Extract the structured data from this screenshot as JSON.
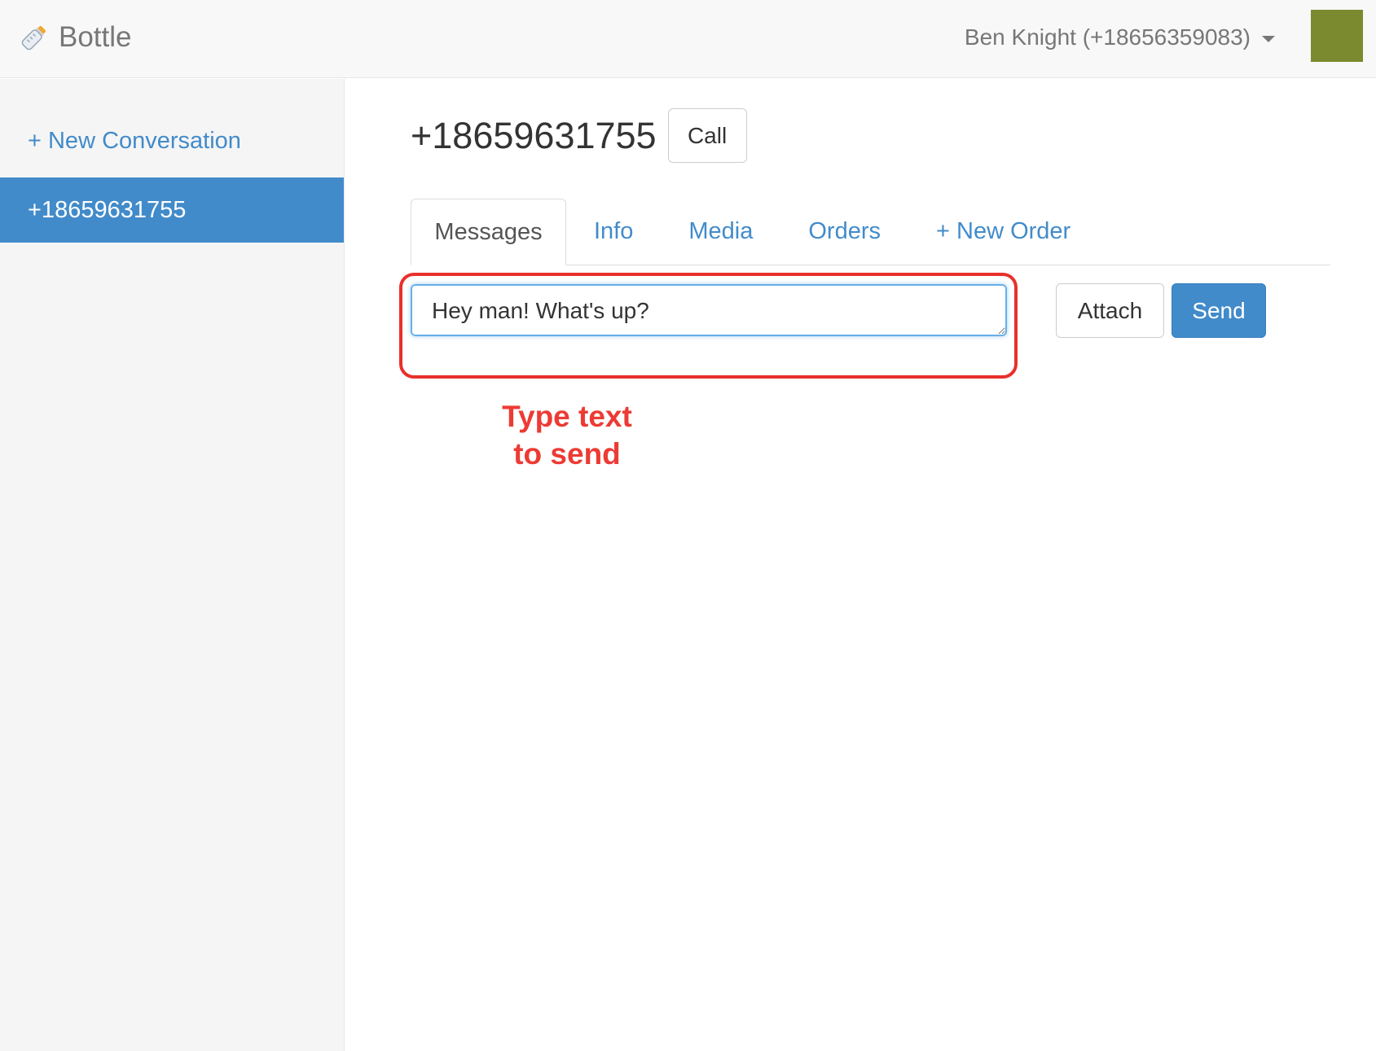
{
  "navbar": {
    "brand": "Bottle",
    "user": "Ben Knight (+18656359083)",
    "avatar_color": "#7b8a2e"
  },
  "sidebar": {
    "new_conversation": "+ New Conversation",
    "conversations": [
      {
        "label": "+18659631755",
        "selected": true
      }
    ]
  },
  "main": {
    "contact_number": "+18659631755",
    "call_label": "Call",
    "tabs": [
      {
        "label": "Messages",
        "active": true
      },
      {
        "label": "Info",
        "active": false
      },
      {
        "label": "Media",
        "active": false
      },
      {
        "label": "Orders",
        "active": false
      },
      {
        "label": "+ New Order",
        "active": false
      }
    ],
    "message_value": "Hey man! What's up?",
    "attach_label": "Attach",
    "send_label": "Send"
  },
  "annotation": {
    "line1": "Type text",
    "line2": "to send",
    "color": "#ec3b34"
  },
  "colors": {
    "accent": "#428bca",
    "highlight": "#e8302a"
  }
}
